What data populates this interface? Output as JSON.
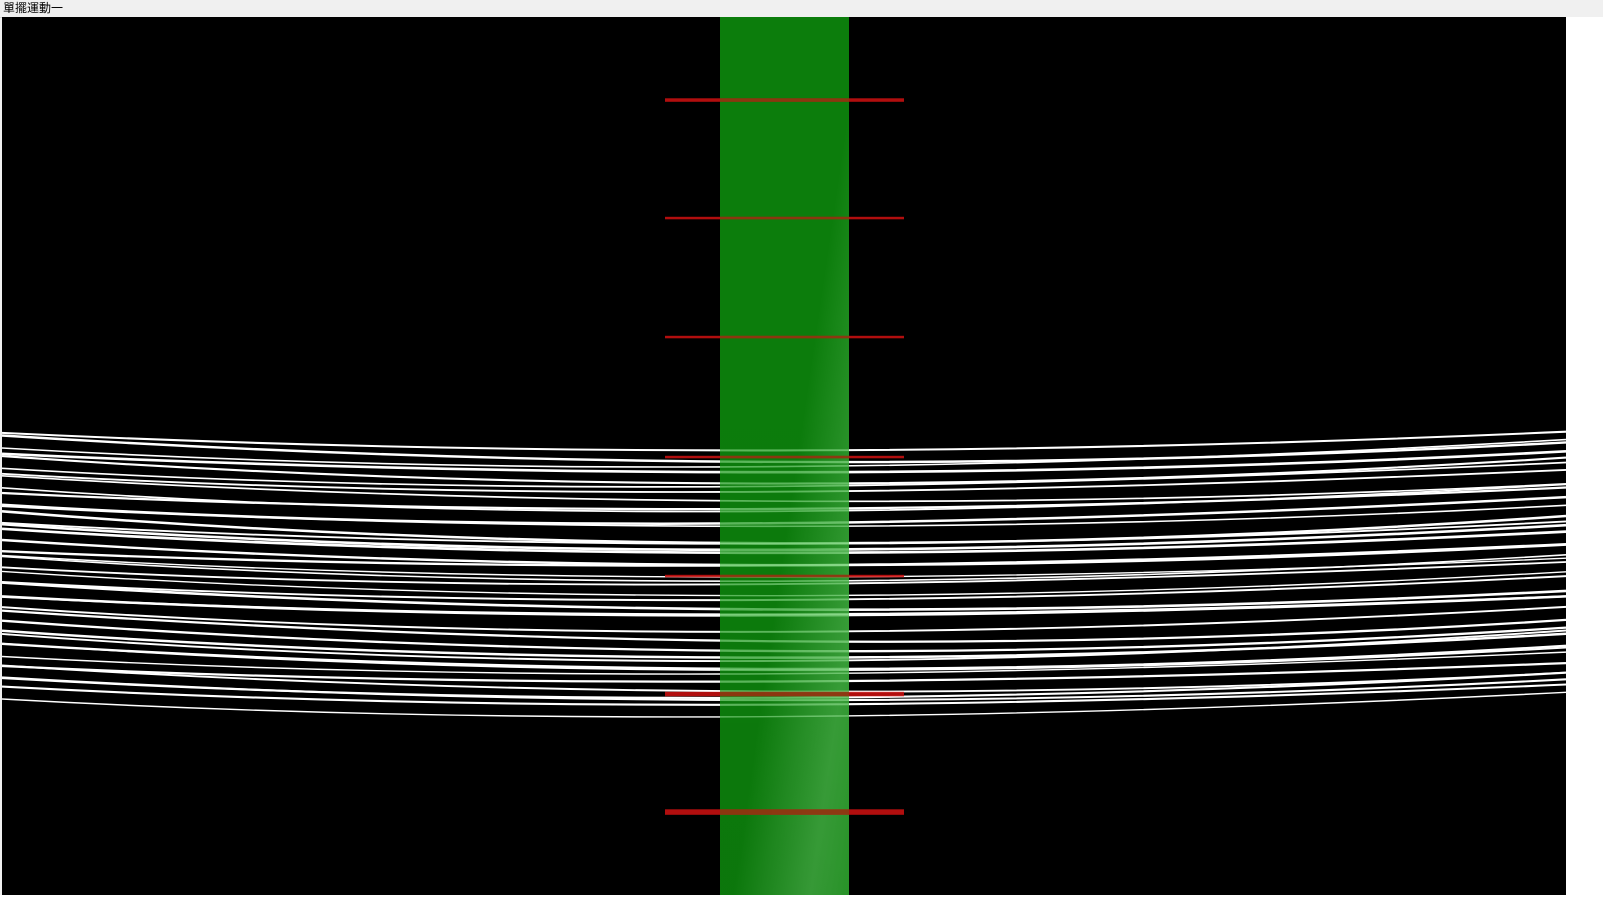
{
  "window": {
    "title": "單擺運動一"
  },
  "scene": {
    "background_color": "#000000",
    "beam_color": "#0a7a0a",
    "beam_highlight_color": "#3aa53a",
    "marker_color": "#d01010",
    "strand_color": "#ffffff",
    "marker_count": 7,
    "strand_count": 40
  }
}
